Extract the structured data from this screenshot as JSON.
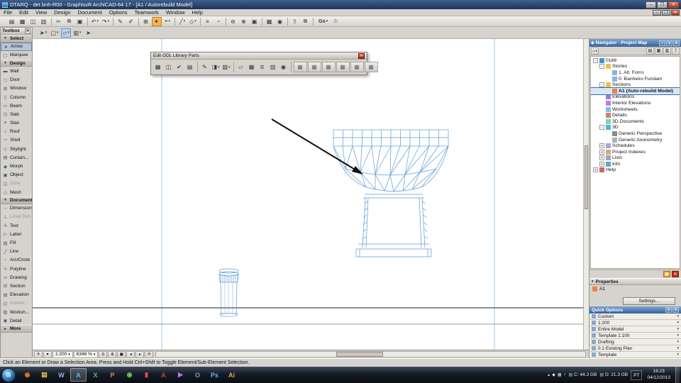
{
  "titlebar": {
    "title": "DTARQ - det bnh-R00 - Graphisoft ArchiCAD-64 17 - [A1 / Autorebuild Model]",
    "buttons": [
      {
        "n": "minimize-button",
        "g": "─"
      },
      {
        "n": "maximize-button",
        "g": "❐"
      },
      {
        "n": "close-button",
        "g": "✕",
        "cls": "close"
      }
    ]
  },
  "menubar": {
    "items": [
      "File",
      "Edit",
      "View",
      "Design",
      "Document",
      "Options",
      "Teamwork",
      "Window",
      "Help"
    ],
    "window_buttons": [
      {
        "n": "child-minimize-button",
        "g": "─"
      },
      {
        "n": "child-restore-button",
        "g": "❐"
      },
      {
        "n": "child-close-button",
        "g": "✕",
        "cls": "close"
      }
    ]
  },
  "toolbar_main": {
    "items": [
      {
        "n": "new-project-icon",
        "g": "▤"
      },
      {
        "n": "open-project-icon",
        "g": "▦"
      },
      {
        "n": "save-icon",
        "g": "◫"
      },
      {
        "n": "print-icon",
        "g": "▥"
      },
      {
        "cls": "sep"
      },
      {
        "n": "cut-icon",
        "g": "✂"
      },
      {
        "n": "copy-icon",
        "g": "⧉"
      },
      {
        "n": "paste-icon",
        "g": "▣"
      },
      {
        "cls": "sep"
      },
      {
        "n": "undo-icon",
        "g": "↶",
        "dd": "▾"
      },
      {
        "n": "redo-icon",
        "g": "↷",
        "dd": "▾"
      },
      {
        "cls": "sep"
      },
      {
        "n": "pick-up-parameters-icon",
        "g": "✎"
      },
      {
        "n": "inject-parameters-icon",
        "g": "✐"
      },
      {
        "cls": "sep"
      },
      {
        "n": "suspend-groups-icon",
        "g": "⊞"
      },
      {
        "n": "magic-wand-icon",
        "g": "✦",
        "cls": "hl"
      },
      {
        "n": "gravity-icon",
        "g": "⌖",
        "dd": "▾"
      },
      {
        "cls": "sep"
      },
      {
        "n": "guide-lines-icon",
        "g": "╱",
        "dd": "▾"
      },
      {
        "n": "snap-points-icon",
        "g": "◇",
        "dd": "▾"
      },
      {
        "cls": "sep"
      },
      {
        "n": "layers-icon",
        "g": "≡"
      },
      {
        "n": "scale-icon",
        "g": "◔"
      },
      {
        "cls": "sep"
      },
      {
        "n": "zoom-out-icon",
        "g": "⊖"
      },
      {
        "n": "zoom-in-icon",
        "g": "⊕"
      },
      {
        "n": "fit-in-window-icon",
        "g": "▣"
      },
      {
        "cls": "sep"
      },
      {
        "n": "3d-window-icon",
        "g": "▦"
      },
      {
        "n": "camera-icon",
        "g": "◉"
      },
      {
        "cls": "sep"
      },
      {
        "n": "publisher-icon",
        "g": "⇧"
      },
      {
        "n": "organizer-icon",
        "g": "⧉"
      },
      {
        "cls": "sep"
      },
      {
        "n": "go-button",
        "g": "Go",
        "dd": "▾",
        "cls": "txt"
      },
      {
        "n": "start-presentation-icon",
        "g": "⚐"
      }
    ]
  },
  "toolbar_draw": {
    "items": [
      {
        "n": "arrow-tool-icon",
        "g": "➤",
        "dd": "▾"
      },
      {
        "n": "marquee-tool-icon",
        "g": "▢",
        "dd": "▾"
      },
      {
        "n": "drawing-tool-icon",
        "g": "▱",
        "cls": "pressed",
        "dd": "▾"
      },
      {
        "n": "trace-reference-icon",
        "g": "▥",
        "dd": "▾"
      },
      {
        "n": "cursor-icon",
        "g": "➤"
      }
    ]
  },
  "toolbox": {
    "title": "Toolbox",
    "rows": [
      {
        "n": "toolbox-group-select",
        "cls": "hdr",
        "g": "▾",
        "label": "Select"
      },
      {
        "n": "toolbox-item-arrow",
        "cls": "sel",
        "g": "➤",
        "label": "Arrow"
      },
      {
        "n": "toolbox-item-marquee",
        "g": "▢",
        "label": "Marquee"
      },
      {
        "n": "toolbox-group-design",
        "cls": "hdr",
        "g": "▾",
        "label": "Design"
      },
      {
        "n": "toolbox-item-wall",
        "g": "▬",
        "label": "Wall"
      },
      {
        "n": "toolbox-item-door",
        "g": "◻",
        "label": "Door"
      },
      {
        "n": "toolbox-item-window",
        "g": "⊞",
        "label": "Window"
      },
      {
        "n": "toolbox-item-column",
        "g": "▯",
        "label": "Column"
      },
      {
        "n": "toolbox-item-beam",
        "g": "▭",
        "label": "Beam"
      },
      {
        "n": "toolbox-item-slab",
        "g": "◫",
        "label": "Slab"
      },
      {
        "n": "toolbox-item-stair",
        "g": "≡",
        "label": "Stair"
      },
      {
        "n": "toolbox-item-roof",
        "g": "⌂",
        "label": "Roof"
      },
      {
        "n": "toolbox-item-shell",
        "g": "◠",
        "label": "Shell"
      },
      {
        "n": "toolbox-item-skylight",
        "g": "◇",
        "label": "Skylight"
      },
      {
        "n": "toolbox-item-curtain-wall",
        "g": "▤",
        "label": "Curtain..."
      },
      {
        "n": "toolbox-item-morph",
        "g": "◆",
        "label": "Morph"
      },
      {
        "n": "toolbox-item-object",
        "g": "▣",
        "label": "Object"
      },
      {
        "n": "toolbox-item-zone",
        "cls": "dim",
        "g": "◲",
        "label": "Zone"
      },
      {
        "n": "toolbox-item-mesh",
        "g": "△",
        "label": "Mesh"
      },
      {
        "n": "toolbox-group-document",
        "cls": "hdr",
        "g": "▾",
        "label": "Document"
      },
      {
        "n": "toolbox-item-dimension",
        "g": "↔",
        "label": "Dimension"
      },
      {
        "n": "toolbox-item-level-dimension",
        "cls": "dim",
        "g": "⊥",
        "label": "Level Dim."
      },
      {
        "n": "toolbox-item-text",
        "g": "A",
        "label": "Text"
      },
      {
        "n": "toolbox-item-label",
        "g": "▷",
        "label": "Label"
      },
      {
        "n": "toolbox-item-fill",
        "g": "▨",
        "label": "Fill"
      },
      {
        "n": "toolbox-item-line",
        "g": "╱",
        "label": "Line"
      },
      {
        "n": "toolbox-item-arc-circle",
        "g": "○",
        "label": "Arc/Circle"
      },
      {
        "n": "toolbox-item-polyline",
        "g": "∿",
        "label": "Polyline"
      },
      {
        "n": "toolbox-item-drawing",
        "g": "▱",
        "label": "Drawing"
      },
      {
        "n": "toolbox-item-section",
        "g": "⊟",
        "label": "Section"
      },
      {
        "n": "toolbox-item-elevation",
        "g": "▤",
        "label": "Elevation"
      },
      {
        "n": "toolbox-item-interior-elevation",
        "cls": "dim",
        "g": "◱",
        "label": "Interior..."
      },
      {
        "n": "toolbox-item-worksheet",
        "g": "▥",
        "label": "Worksh..."
      },
      {
        "n": "toolbox-item-detail",
        "g": "◉",
        "label": "Detail"
      },
      {
        "n": "toolbox-group-more",
        "cls": "hdr",
        "g": "▸",
        "label": "More"
      }
    ]
  },
  "gdl": {
    "title": "Edit GDL Library Parts",
    "items": [
      {
        "n": "gdl-open-object-icon",
        "g": "▦"
      },
      {
        "n": "gdl-save-icon",
        "g": "◫"
      },
      {
        "n": "gdl-check-script-icon",
        "g": "✔"
      },
      {
        "n": "gdl-new-object-icon",
        "g": "▤"
      },
      {
        "cls": "sep"
      },
      {
        "n": "gdl-pen-icon",
        "g": "✎"
      },
      {
        "n": "gdl-material-icon",
        "g": "◨",
        "dd": "▾"
      },
      {
        "n": "gdl-fill-icon",
        "g": "▨",
        "dd": "▾"
      },
      {
        "cls": "sep"
      },
      {
        "n": "gdl-2d-script-icon",
        "g": "▱"
      },
      {
        "n": "gdl-3d-script-icon",
        "g": "▦"
      },
      {
        "n": "gdl-master-script-icon",
        "g": "≣"
      },
      {
        "n": "gdl-parameters-icon",
        "g": "▥"
      },
      {
        "n": "gdl-preview-icon",
        "g": "◉"
      },
      {
        "cls": "sep"
      },
      {
        "n": "gdl-grid-button-1",
        "g": "▦",
        "cls": "wide"
      },
      {
        "n": "gdl-grid-button-2",
        "g": "▦",
        "cls": "wide"
      },
      {
        "n": "gdl-grid-button-3",
        "g": "▦",
        "cls": "wide"
      },
      {
        "n": "gdl-grid-button-4",
        "g": "▦",
        "cls": "wide"
      },
      {
        "n": "gdl-grid-button-5",
        "g": "▦",
        "cls": "wide"
      },
      {
        "n": "gdl-grid-button-6",
        "g": "▦",
        "cls": "wide"
      }
    ]
  },
  "navigator": {
    "title": "Navigator - Project Map",
    "header_icon": "◈",
    "header_buttons": [
      {
        "n": "navigator-pin-icon",
        "g": "▪"
      },
      {
        "n": "navigator-menu-icon",
        "g": "▾"
      },
      {
        "n": "navigator-close-icon",
        "g": "✕"
      }
    ],
    "toolbar_left": [
      {
        "n": "navigator-project-chooser-icon",
        "g": "⌂",
        "dd": "▾"
      }
    ],
    "toolbar_right": [
      {
        "n": "navigator-project-map-icon",
        "g": "▤"
      },
      {
        "n": "navigator-view-map-icon",
        "g": "▦"
      },
      {
        "n": "navigator-layout-book-icon",
        "g": "▥"
      },
      {
        "n": "navigator-publisher-icon",
        "g": "⇧"
      }
    ],
    "tree": [
      {
        "n": "tree-item-project-0188",
        "level": 0,
        "exp": "-",
        "icon": "proj",
        "label": "0188"
      },
      {
        "n": "tree-item-stories",
        "level": 1,
        "exp": "-",
        "icon": "folder",
        "label": "Stories"
      },
      {
        "n": "tree-item-story-1",
        "level": 2,
        "exp": "",
        "icon": "story",
        "label": "1. Alt. Forro"
      },
      {
        "n": "tree-item-story-0",
        "level": 2,
        "exp": "",
        "icon": "story",
        "label": "0. Banheiro Fundam"
      },
      {
        "n": "tree-item-sections",
        "level": 1,
        "exp": "-",
        "icon": "folder",
        "label": "Sections"
      },
      {
        "n": "tree-item-section-a1",
        "level": 2,
        "exp": "",
        "icon": "section",
        "label": "A1 (Auto-rebuild Model)",
        "cls": "sel"
      },
      {
        "n": "tree-item-elevations",
        "level": 1,
        "exp": "",
        "icon": "elev",
        "label": "Elevations"
      },
      {
        "n": "tree-item-interior-elevations",
        "level": 1,
        "exp": "",
        "icon": "ielev",
        "label": "Interior Elevations"
      },
      {
        "n": "tree-item-worksheets",
        "level": 1,
        "exp": "",
        "icon": "wks",
        "label": "Worksheets"
      },
      {
        "n": "tree-item-details",
        "level": 1,
        "exp": "",
        "icon": "det",
        "label": "Details"
      },
      {
        "n": "tree-item-3d-documents",
        "level": 1,
        "exp": "",
        "icon": "d3doc",
        "label": "3D Documents"
      },
      {
        "n": "tree-item-3d",
        "level": 1,
        "exp": "-",
        "icon": "d3",
        "label": "3D"
      },
      {
        "n": "tree-item-generic-perspective",
        "level": 2,
        "exp": "",
        "icon": "persp",
        "label": "Generic Perspective"
      },
      {
        "n": "tree-item-generic-axonometry",
        "level": 2,
        "exp": "",
        "icon": "axo",
        "label": "Generic Axonometry"
      },
      {
        "n": "tree-item-schedules",
        "level": 1,
        "exp": "+",
        "icon": "sched",
        "label": "Schedules"
      },
      {
        "n": "tree-item-project-indexes",
        "level": 1,
        "exp": "+",
        "icon": "pidx",
        "label": "Project Indexes"
      },
      {
        "n": "tree-item-lists",
        "level": 1,
        "exp": "+",
        "icon": "lists",
        "label": "Lists"
      },
      {
        "n": "tree-item-info",
        "level": 1,
        "exp": "+",
        "icon": "info",
        "label": "Info"
      },
      {
        "n": "tree-item-help",
        "level": 0,
        "exp": "+",
        "icon": "help",
        "label": "Help"
      }
    ],
    "bottom_buttons": [
      {
        "n": "auto-rebuild-icon",
        "g": "▣",
        "cls": "orange"
      },
      {
        "n": "close-viewpoint-icon",
        "g": "✕",
        "cls": "red"
      }
    ]
  },
  "properties": {
    "header": "Properties",
    "collapse": "▾",
    "item_label": "A1",
    "settings_label": "Settings..."
  },
  "quick_options": {
    "title": "Quick Options",
    "header_buttons": [
      {
        "n": "quick-options-menu-icon",
        "g": "▾"
      },
      {
        "n": "quick-options-close-icon",
        "g": "✕"
      }
    ],
    "items": [
      {
        "n": "quick-option-layer-combination",
        "label": "Custom",
        "dd": "▾"
      },
      {
        "n": "quick-option-scale",
        "label": "1:200",
        "dd": "▾"
      },
      {
        "n": "quick-option-structure-display",
        "label": "Entire Model",
        "dd": "▾"
      },
      {
        "n": "quick-option-pen-set",
        "label": "Template 1:100",
        "dd": "▾"
      },
      {
        "n": "quick-option-model-view",
        "label": "Drafting",
        "dd": "▾"
      },
      {
        "n": "quick-option-graphic-override",
        "label": "0.1 Existing Plan",
        "dd": "▾"
      },
      {
        "n": "quick-option-renovation-filter",
        "label": "Template",
        "dd": "▾"
      }
    ]
  },
  "canvas_footer": {
    "scale": "1:200",
    "zoom": "6346 %",
    "left": [
      {
        "n": "tracker-icon",
        "g": "✛"
      },
      {
        "n": "pet-palette-icon",
        "g": "▾"
      }
    ],
    "right": [
      {
        "n": "zoom-out-icon",
        "g": "⊖"
      },
      {
        "n": "zoom-in-icon",
        "g": "⊕"
      },
      {
        "n": "fit-in-window-icon",
        "g": "▣"
      },
      {
        "n": "previous-zoom-icon",
        "g": "◂"
      },
      {
        "n": "next-zoom-icon",
        "g": "▸"
      },
      {
        "n": "rotate-view-icon",
        "g": "⟳"
      }
    ]
  },
  "statusbar": {
    "text": "Click an Element or Draw a Selection Area. Press and Hold Ctrl+Shift to Toggle Element/Sub-Element Selection."
  },
  "taskbar": {
    "start_glyph": "⊞",
    "apps": [
      {
        "n": "taskbar-app-firefox",
        "g": "◉",
        "c": "#e87722"
      },
      {
        "n": "taskbar-app-explorer",
        "g": "▤",
        "c": "#ecc25a"
      },
      {
        "n": "taskbar-app-word",
        "g": "W",
        "c": "#9ab6e0"
      },
      {
        "n": "taskbar-app-archicad",
        "g": "A",
        "c": "#58c0e8",
        "cls": "active"
      },
      {
        "n": "taskbar-app-excel",
        "g": "X",
        "c": "#5ac47a"
      },
      {
        "n": "taskbar-app-powerpoint",
        "g": "P",
        "c": "#e8865a"
      },
      {
        "n": "taskbar-app-chrome",
        "g": "◉",
        "c": "#7ac25a"
      },
      {
        "n": "taskbar-app-acrobat",
        "g": "▮",
        "c": "#e05050"
      },
      {
        "n": "taskbar-app-autocad",
        "g": "A",
        "c": "#d04040"
      },
      {
        "n": "taskbar-app-media-player",
        "g": "▶",
        "c": "#b07ae0"
      },
      {
        "n": "taskbar-app-outlook",
        "g": "O",
        "c": "#6aa0e0"
      },
      {
        "n": "taskbar-app-photoshop",
        "g": "Ps",
        "c": "#70b0e8"
      },
      {
        "n": "taskbar-app-illustrator",
        "g": "Ai",
        "c": "#e8a050"
      }
    ],
    "tray": {
      "icons": [
        {
          "n": "tray-hidden-icons-chevron",
          "g": "▴"
        },
        {
          "n": "tray-antivirus-icon",
          "g": "◆"
        },
        {
          "n": "tray-network-icon",
          "g": "▦"
        },
        {
          "n": "tray-volume-icon",
          "g": "♪"
        }
      ],
      "c_drive": "C: 44.3 GB",
      "d_drive": "D: 21.3 GB",
      "lang": "PT",
      "time": "16:23",
      "date": "04/12/2013"
    }
  }
}
